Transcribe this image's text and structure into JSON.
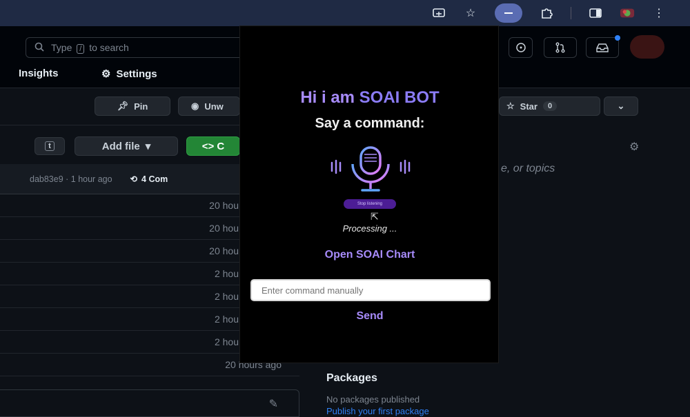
{
  "browser": {
    "icons": [
      "cast-icon",
      "star-icon",
      "extension-active-icon",
      "puzzle-icon",
      "sidepanel-icon",
      "profile-icon",
      "menu-icon"
    ]
  },
  "header": {
    "search_placeholder": "Type",
    "search_key": "/",
    "search_suffix": "to search"
  },
  "tabs": {
    "insights": "Insights",
    "settings": "Settings"
  },
  "repo": {
    "pin": "Pin",
    "unwatch": "Unw",
    "star": "Star",
    "star_count": "0",
    "t_key": "t",
    "add_file": "Add file",
    "code": "<> C",
    "commit_hash_time": "dab83e9 · 1 hour ago",
    "commits": "4 Com",
    "about_text": "e, or topics",
    "rows": [
      "20 hou",
      "20 hou",
      "20 hou",
      "2 hou",
      "2 hou",
      "2 hou",
      "2 hou",
      "20 hours ago"
    ]
  },
  "packages": {
    "title": "Packages",
    "none": "No packages published",
    "publish": "Publish your first package"
  },
  "popup": {
    "title_prefix": "Hi i am ",
    "title_brand": "SOAI BOT",
    "prompt": "Say a command:",
    "status_pill": "Stop listening",
    "processing": "Processing ...",
    "open_chart": "Open SOAI Chart",
    "input_placeholder": "Enter command manually",
    "send": "Send"
  },
  "colors": {
    "accent_purple": "#a78bfa",
    "mic_pink": "#e879f9",
    "mic_blue": "#60a5fa",
    "green_code": "#238636"
  }
}
